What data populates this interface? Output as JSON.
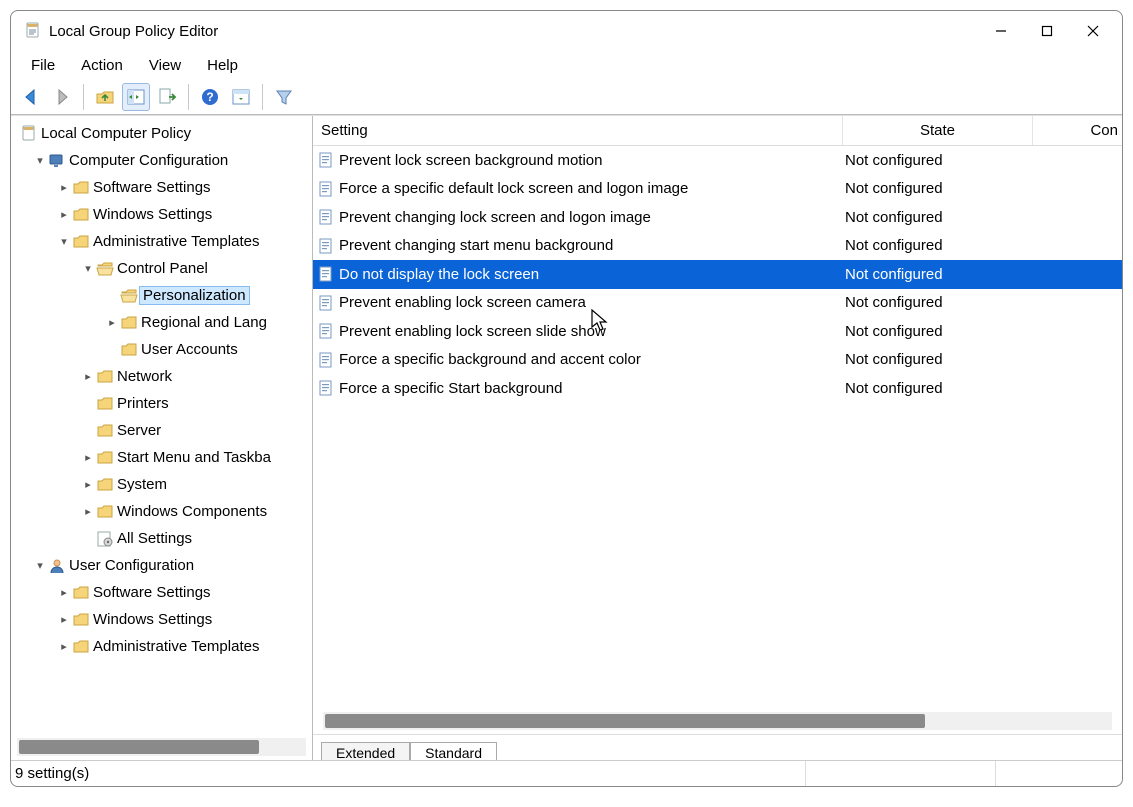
{
  "title": "Local Group Policy Editor",
  "menu": {
    "file": "File",
    "action": "Action",
    "view": "View",
    "help": "Help"
  },
  "tree": {
    "root": "Local Computer Policy",
    "cc": "Computer Configuration",
    "cc_sw": "Software Settings",
    "cc_win": "Windows Settings",
    "cc_adm": "Administrative Templates",
    "cp": "Control Panel",
    "pers": "Personalization",
    "reg": "Regional and Lang",
    "ua": "User Accounts",
    "net": "Network",
    "prn": "Printers",
    "srv": "Server",
    "smt": "Start Menu and Taskba",
    "sys": "System",
    "wc": "Windows Components",
    "all": "All Settings",
    "uc": "User Configuration",
    "uc_sw": "Software Settings",
    "uc_win": "Windows Settings",
    "uc_adm": "Administrative Templates"
  },
  "columns": {
    "setting": "Setting",
    "state": "State",
    "comment": "Con"
  },
  "rows": [
    {
      "name": "Prevent lock screen background motion",
      "state": "Not configured"
    },
    {
      "name": "Force a specific default lock screen and logon image",
      "state": "Not configured"
    },
    {
      "name": "Prevent changing lock screen and logon image",
      "state": "Not configured"
    },
    {
      "name": "Prevent changing start menu background",
      "state": "Not configured"
    },
    {
      "name": "Do not display the lock screen",
      "state": "Not configured",
      "selected": true
    },
    {
      "name": "Prevent enabling lock screen camera",
      "state": "Not configured"
    },
    {
      "name": "Prevent enabling lock screen slide show",
      "state": "Not configured"
    },
    {
      "name": "Force a specific background and accent color",
      "state": "Not configured"
    },
    {
      "name": "Force a specific Start background",
      "state": "Not configured"
    }
  ],
  "tabs": {
    "extended": "Extended",
    "standard": "Standard"
  },
  "status": "9 setting(s)"
}
